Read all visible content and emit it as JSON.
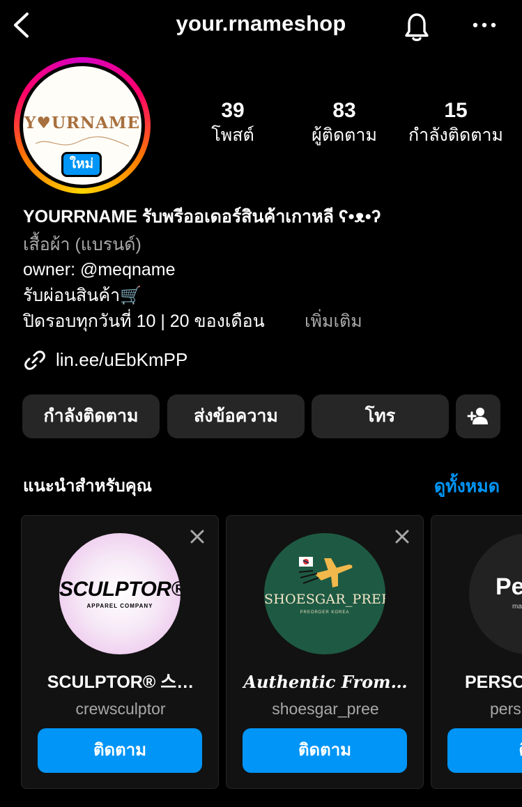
{
  "header": {
    "username": "your.rnameshop",
    "icons": [
      "chevron-left-icon",
      "bell-icon",
      "more-icon"
    ]
  },
  "profile": {
    "avatar_logo_text": "Y♥URNAME",
    "new_badge": "ใหม่",
    "stats": {
      "posts": {
        "value": "39",
        "label": "โพสต์"
      },
      "followers": {
        "value": "83",
        "label": "ผู้ติดตาม"
      },
      "following": {
        "value": "15",
        "label": "กำลังติดตาม"
      }
    },
    "bio": {
      "name": "YOURRNAME รับพรีออเดอร์สินค้าเกาหลี ʕ•ᴥ•ʔ",
      "category": "เสื้อผ้า (แบรนด์)",
      "owner": "owner: @meqname",
      "line1": "รับผ่อนสินค้า🛒",
      "line2": "ปิดรอบทุกวันที่ 10 | 20 ของเดือน",
      "more": "เพิ่มเติม",
      "link": "lin.ee/uEbKmPP"
    }
  },
  "actions": {
    "following": "กำลังติดตาม",
    "message": "ส่งข้อความ",
    "call": "โทร"
  },
  "suggestions": {
    "title": "แนะนำสำหรับคุณ",
    "see_all": "ดูทั้งหมด",
    "cards": [
      {
        "name": "SCULPTOR® 스…",
        "handle": "crewsculptor",
        "follow": "ติดตาม",
        "pic_brand": "SCULPTOR®",
        "pic_sub": "APPAREL COMPANY"
      },
      {
        "name": "Authentic From…",
        "handle": "shoesgar_pree",
        "follow": "ติดตาม",
        "pic_brand": "SHOESGAR_PREE",
        "pic_sub": "PREORDER KOREA"
      },
      {
        "name": "PERSO",
        "handle": "pers",
        "follow": "ติด",
        "pic_brand": "Per",
        "pic_sub": "mad"
      }
    ]
  },
  "colors": {
    "background": "#000000",
    "accent": "#0095f6",
    "button": "#262626",
    "muted": "#a8a8a8"
  }
}
